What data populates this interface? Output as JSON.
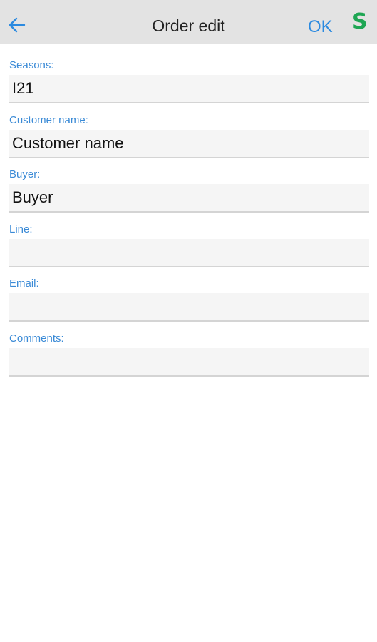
{
  "header": {
    "title": "Order edit",
    "ok_label": "OK",
    "s_icon_text": "S",
    "back_icon": "arrow-left-icon"
  },
  "colors": {
    "accent": "#2b8ae0",
    "label": "#3a8ad6",
    "brand_green": "#1ea653",
    "navbar_bg": "#e3e3e3"
  },
  "form": {
    "fields": [
      {
        "label": "Seasons:",
        "value": "I21"
      },
      {
        "label": "Customer name:",
        "value": "Customer name"
      },
      {
        "label": "Buyer:",
        "value": "Buyer"
      },
      {
        "label": "Line:",
        "value": ""
      },
      {
        "label": "Email:",
        "value": ""
      },
      {
        "label": "Comments:",
        "value": ""
      }
    ]
  }
}
